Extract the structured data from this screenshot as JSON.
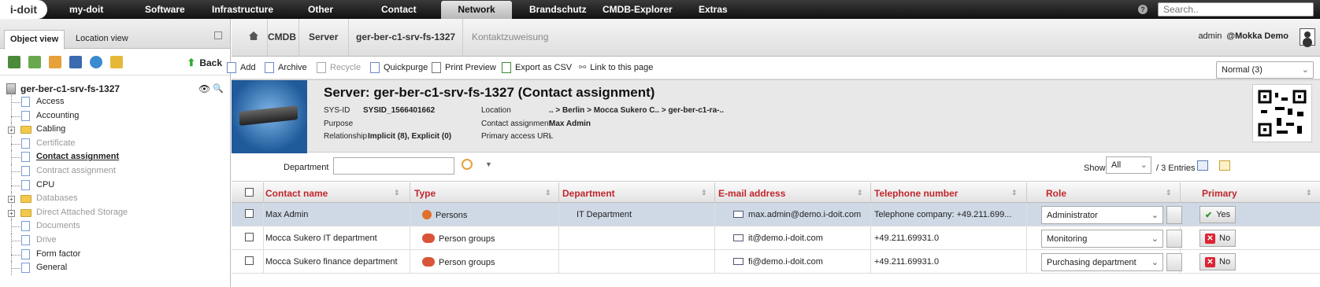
{
  "topnav": {
    "logo": "i-doit",
    "items": [
      "my-doit",
      "Software",
      "Infrastructure",
      "Other",
      "Contact",
      "Network",
      "Brandschutz",
      "CMDB-Explorer",
      "Extras"
    ],
    "active": "Network",
    "search_placeholder": "Search.."
  },
  "left": {
    "tabs": [
      "Object view",
      "Location view"
    ],
    "back_label": "Back",
    "root": "ger-ber-c1-srv-fs-1327",
    "tree": [
      {
        "label": "Access",
        "kind": "doc",
        "state": "normal"
      },
      {
        "label": "Accounting",
        "kind": "doc",
        "state": "normal"
      },
      {
        "label": "Cabling",
        "kind": "folder",
        "state": "normal"
      },
      {
        "label": "Certificate",
        "kind": "doc",
        "state": "muted"
      },
      {
        "label": "Contact assignment",
        "kind": "doc",
        "state": "current"
      },
      {
        "label": "Contract assignment",
        "kind": "doc",
        "state": "muted"
      },
      {
        "label": "CPU",
        "kind": "doc",
        "state": "normal"
      },
      {
        "label": "Databases",
        "kind": "folder",
        "state": "muted"
      },
      {
        "label": "Direct Attached Storage",
        "kind": "folder",
        "state": "muted"
      },
      {
        "label": "Documents",
        "kind": "doc",
        "state": "muted"
      },
      {
        "label": "Drive",
        "kind": "doc",
        "state": "muted"
      },
      {
        "label": "Form factor",
        "kind": "doc",
        "state": "normal"
      },
      {
        "label": "General",
        "kind": "doc",
        "state": "normal"
      }
    ]
  },
  "breadcrumb": [
    "CMDB",
    "Server",
    "ger-ber-c1-srv-fs-1327",
    "Kontaktzuweisung"
  ],
  "user": {
    "name": "admin",
    "tenant": "@Mokka Demo"
  },
  "toolbar": {
    "add": "Add",
    "archive": "Archive",
    "recycle": "Recycle",
    "quickpurge": "Quickpurge",
    "print": "Print Preview",
    "export": "Export as CSV",
    "link": "Link to this page",
    "status": "Normal (3)"
  },
  "object": {
    "title": "Server: ger-ber-c1-srv-fs-1327 (Contact assignment)",
    "sysid_label": "SYS-ID",
    "sysid": "SYSID_1566401662",
    "purpose_label": "Purpose",
    "purpose": "",
    "relationship_label": "Relationship",
    "relationship": "Implicit (8), Explicit (0)",
    "location_label": "Location",
    "location": ".. > Berlin > Mocca Sukero C.. > ger-ber-c1-ra-..",
    "contact_label": "Contact assignment",
    "contact": "Max Admin",
    "url_label": "Primary access URL",
    "url": "-"
  },
  "filter": {
    "label": "Department",
    "show_label": "Show",
    "show_value": "All",
    "entries": "/ 3 Entries"
  },
  "grid": {
    "headers": [
      "Contact name",
      "Type",
      "Department",
      "E-mail address",
      "Telephone number",
      "Role",
      "Primary"
    ],
    "rows": [
      {
        "name": "Max Admin",
        "type": "Persons",
        "department": "IT Department",
        "email": "max.admin@demo.i-doit.com",
        "phone": "Telephone company: +49.211.699...",
        "role": "Administrator",
        "primary": "Yes"
      },
      {
        "name": "Mocca Sukero IT department",
        "type": "Person groups",
        "department": "",
        "email": "it@demo.i-doit.com",
        "phone": "+49.211.69931.0",
        "role": "Monitoring",
        "primary": "No"
      },
      {
        "name": "Mocca Sukero finance department",
        "type": "Person groups",
        "department": "",
        "email": "fi@demo.i-doit.com",
        "phone": "+49.211.69931.0",
        "role": "Purchasing department",
        "primary": "No"
      }
    ]
  },
  "colors": {
    "header_red": "#c0272d",
    "selected_row": "#cfd9e6",
    "nav_dark": "#111111"
  }
}
